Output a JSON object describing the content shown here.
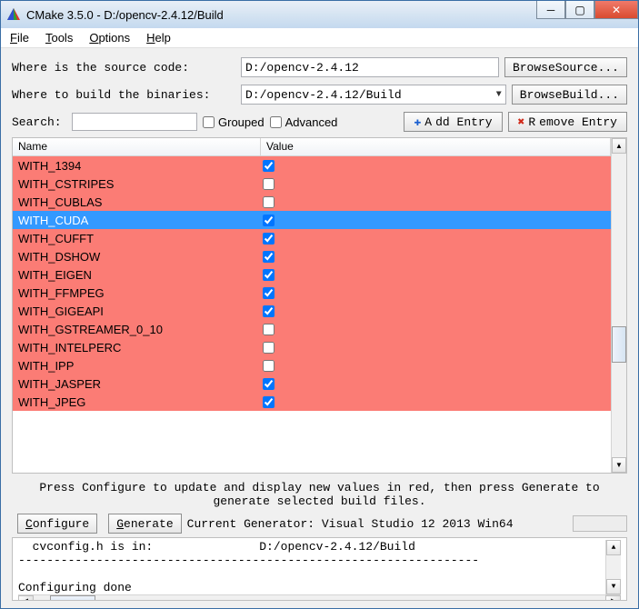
{
  "title": "CMake 3.5.0 - D:/opencv-2.4.12/Build",
  "menu": {
    "file": "File",
    "tools": "Tools",
    "options": "Options",
    "help": "Help"
  },
  "source_row": {
    "label": "Where is the source code:",
    "value": "D:/opencv-2.4.12",
    "browse": "Browse Source..."
  },
  "build_row": {
    "label": "Where to build the binaries:",
    "value": "D:/opencv-2.4.12/Build",
    "browse": "Browse Build..."
  },
  "search": {
    "label": "Search:",
    "grouped": "Grouped",
    "advanced": "Advanced",
    "add": "Add Entry",
    "remove": "Remove Entry"
  },
  "columns": {
    "name": "Name",
    "value": "Value"
  },
  "rows": [
    {
      "name": "WITH_1394",
      "checked": true,
      "selected": false
    },
    {
      "name": "WITH_CSTRIPES",
      "checked": false,
      "selected": false
    },
    {
      "name": "WITH_CUBLAS",
      "checked": false,
      "selected": false
    },
    {
      "name": "WITH_CUDA",
      "checked": true,
      "selected": true
    },
    {
      "name": "WITH_CUFFT",
      "checked": true,
      "selected": false
    },
    {
      "name": "WITH_DSHOW",
      "checked": true,
      "selected": false
    },
    {
      "name": "WITH_EIGEN",
      "checked": true,
      "selected": false
    },
    {
      "name": "WITH_FFMPEG",
      "checked": true,
      "selected": false
    },
    {
      "name": "WITH_GIGEAPI",
      "checked": true,
      "selected": false
    },
    {
      "name": "WITH_GSTREAMER_0_10",
      "checked": false,
      "selected": false
    },
    {
      "name": "WITH_INTELPERC",
      "checked": false,
      "selected": false
    },
    {
      "name": "WITH_IPP",
      "checked": false,
      "selected": false
    },
    {
      "name": "WITH_JASPER",
      "checked": true,
      "selected": false
    },
    {
      "name": "WITH_JPEG",
      "checked": true,
      "selected": false
    }
  ],
  "hint": "Press Configure to update and display new values in red, then press Generate to generate selected build files.",
  "buttons": {
    "configure": "Configure",
    "generate": "Generate"
  },
  "generator": "Current Generator: Visual Studio 12 2013 Win64",
  "output": {
    "lines": "  cvconfig.h is in:               D:/opencv-2.4.12/Build\n-----------------------------------------------------------------\n\nConfiguring done"
  }
}
